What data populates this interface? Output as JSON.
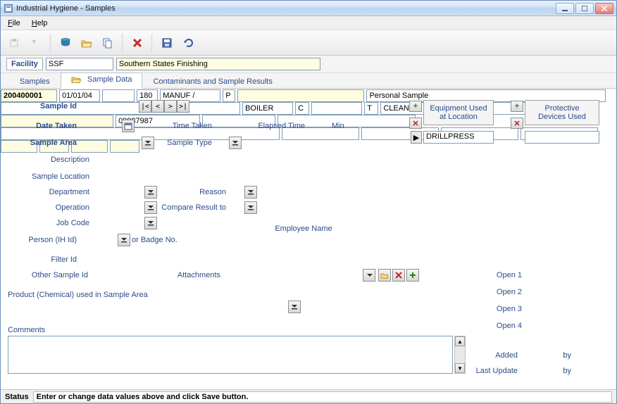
{
  "window": {
    "title": "Industrial Hygiene - Samples"
  },
  "menu": {
    "file": "File",
    "help": "Help"
  },
  "facility": {
    "label": "Facility",
    "code": "SSF",
    "name": "Southern States Finishing"
  },
  "tabs": {
    "samples": "Samples",
    "sample_data": "Sample Data",
    "contaminants": "Contaminants and Sample Results"
  },
  "labels": {
    "sample_id": "Sample Id",
    "date_taken": "Date Taken",
    "time_taken": "Time Taken",
    "elapsed_time": "Elapsed Time",
    "min": "Min",
    "sample_area": "Sample Area",
    "sample_type": "Sample Type",
    "description": "Description",
    "sample_location": "Sample Location",
    "department": "Department",
    "operation": "Operation",
    "job_code": "Job Code",
    "person": "Person (IH Id)",
    "or_badge": "or Badge No.",
    "employee_name": "Employee Name",
    "filter_id": "Filter Id",
    "other_sample_id": "Other Sample Id",
    "attachments": "Attachments",
    "product_chem": "Product (Chemical) used in Sample Area",
    "comments": "Comments",
    "reason": "Reason",
    "compare_result": "Compare Result to",
    "equipment_used": "Equipment Used\nat Location",
    "protective_devices": "Protective\nDevices Used",
    "open1": "Open 1",
    "open2": "Open 2",
    "open3": "Open 3",
    "open4": "Open 4",
    "added": "Added",
    "last_update": "Last Update",
    "by": "by"
  },
  "values": {
    "sample_id": "200400001",
    "date_taken": "01/01/04",
    "time_taken": "",
    "elapsed_time": "180",
    "sample_area": "MANUF /",
    "sample_type": "P",
    "sample_type_desc": "",
    "description": "Personal Sample",
    "sample_location": "",
    "department": "BOILER",
    "operation": "",
    "job_code": "CLEANER",
    "person": "",
    "badge_no": "",
    "employee_name": "",
    "filter_id": "09987987",
    "other_sample_id": "",
    "attachments": "",
    "product_chem": "",
    "comments": "",
    "reason": "C",
    "compare_result": "T",
    "equipment_row": "DRILLPRESS",
    "protective_row": "",
    "open1": "",
    "open2": "",
    "open3": "",
    "open4": "",
    "added": "",
    "added_by": "",
    "last_update": "",
    "last_update_by": ""
  },
  "status": {
    "label": "Status",
    "text": "Enter or change data values above and click Save button."
  },
  "nav": {
    "first": "|<",
    "prev": "<",
    "next": ">",
    "last": ">|"
  }
}
